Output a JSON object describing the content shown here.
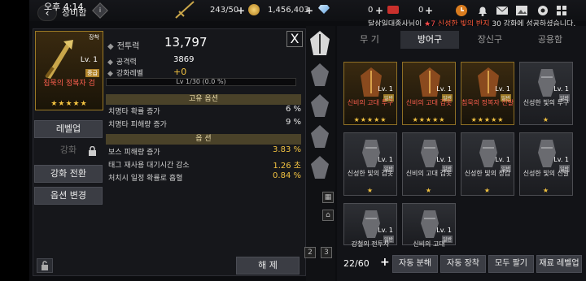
{
  "status_bar": {
    "time": "오후 4:14"
  },
  "header": {
    "title": "장비함",
    "resources": {
      "stamina": "243/50",
      "gold": "1,456,403",
      "gem": "0",
      "ticket": "0"
    },
    "notification": {
      "prefix": "달삼일대종사님이",
      "star": "★7",
      "item": "신성한 빛의 반지",
      "suffix": "30 강화에 성공하셨습니다."
    }
  },
  "item_detail": {
    "equipped_label": "장착",
    "level": "Lv. 1",
    "rarity": "중급",
    "name": "침묵의 정복자 검",
    "stars": "★★★★★",
    "combat_power_label": "전투력",
    "combat_power": "13,797",
    "attack_label": "공격력",
    "attack": "3869",
    "enhance_label": "강화레벨",
    "enhance": "+0",
    "exp_text": "Lv 1/30 (0.0 %)",
    "exp_progress": 0.0,
    "unique_options_header": "고유 옵션",
    "unique_options": [
      {
        "label": "치명타 확률 증가",
        "value": "6 %"
      },
      {
        "label": "치명타 피해량 증가",
        "value": "9 %"
      }
    ],
    "options_header": "옵 션",
    "options": [
      {
        "label": "보스 피해량 증가",
        "value": "3.83 %"
      },
      {
        "label": "태그 재사용 대기시간 감소",
        "value": "1.26 초"
      },
      {
        "label": "처치시 일정 확률로 흡혈",
        "value": "0.84 %"
      }
    ],
    "buttons": {
      "levelup": "레벨업",
      "enhance": "강화",
      "enhance_convert": "강화 전환",
      "option_change": "옵션 변경",
      "release": "해 제"
    }
  },
  "inventory": {
    "tabs": [
      "무 기",
      "방어구",
      "장신구",
      "공용함"
    ],
    "active_tab": 1,
    "items": [
      {
        "lv": "Lv. 1",
        "tier": "일반",
        "name": "신비의 고대 투구",
        "stars": "★★★★★",
        "red": true
      },
      {
        "lv": "Lv. 1",
        "tier": "일반",
        "name": "신비의 고대 갑옷",
        "stars": "★★★★★",
        "red": true
      },
      {
        "lv": "Lv. 1",
        "tier": "일반",
        "name": "침묵의 정복자 신발",
        "stars": "★★★★★",
        "red": true
      },
      {
        "lv": "Lv. 1",
        "tier": "일반",
        "name": "신성한 빛의 투구",
        "stars": "★",
        "red": false
      },
      {
        "lv": "Lv. 1",
        "tier": "일반",
        "name": "신성한 빛의 갑옷",
        "stars": "★",
        "red": false
      },
      {
        "lv": "Lv. 1",
        "tier": "일반",
        "name": "신비의 고대 갑옷",
        "stars": "★",
        "red": false
      },
      {
        "lv": "Lv. 1",
        "tier": "일반",
        "name": "신성한 빛의 장갑",
        "stars": "★",
        "red": false
      },
      {
        "lv": "Lv. 1",
        "tier": "일반",
        "name": "신성한 빛의 신발",
        "stars": "★",
        "red": false
      },
      {
        "lv": "Lv. 1",
        "tier": "일반",
        "name": "강철의 전투사",
        "stars": "",
        "red": false
      },
      {
        "lv": "Lv. 1",
        "tier": "일반",
        "name": "신비의 고대",
        "stars": "",
        "red": false
      }
    ],
    "capacity": "22/60",
    "actions": [
      "자동 분해",
      "자동 장착",
      "모두 팔기",
      "재료 레벨업"
    ],
    "page_numbers": [
      "2",
      "3"
    ]
  }
}
